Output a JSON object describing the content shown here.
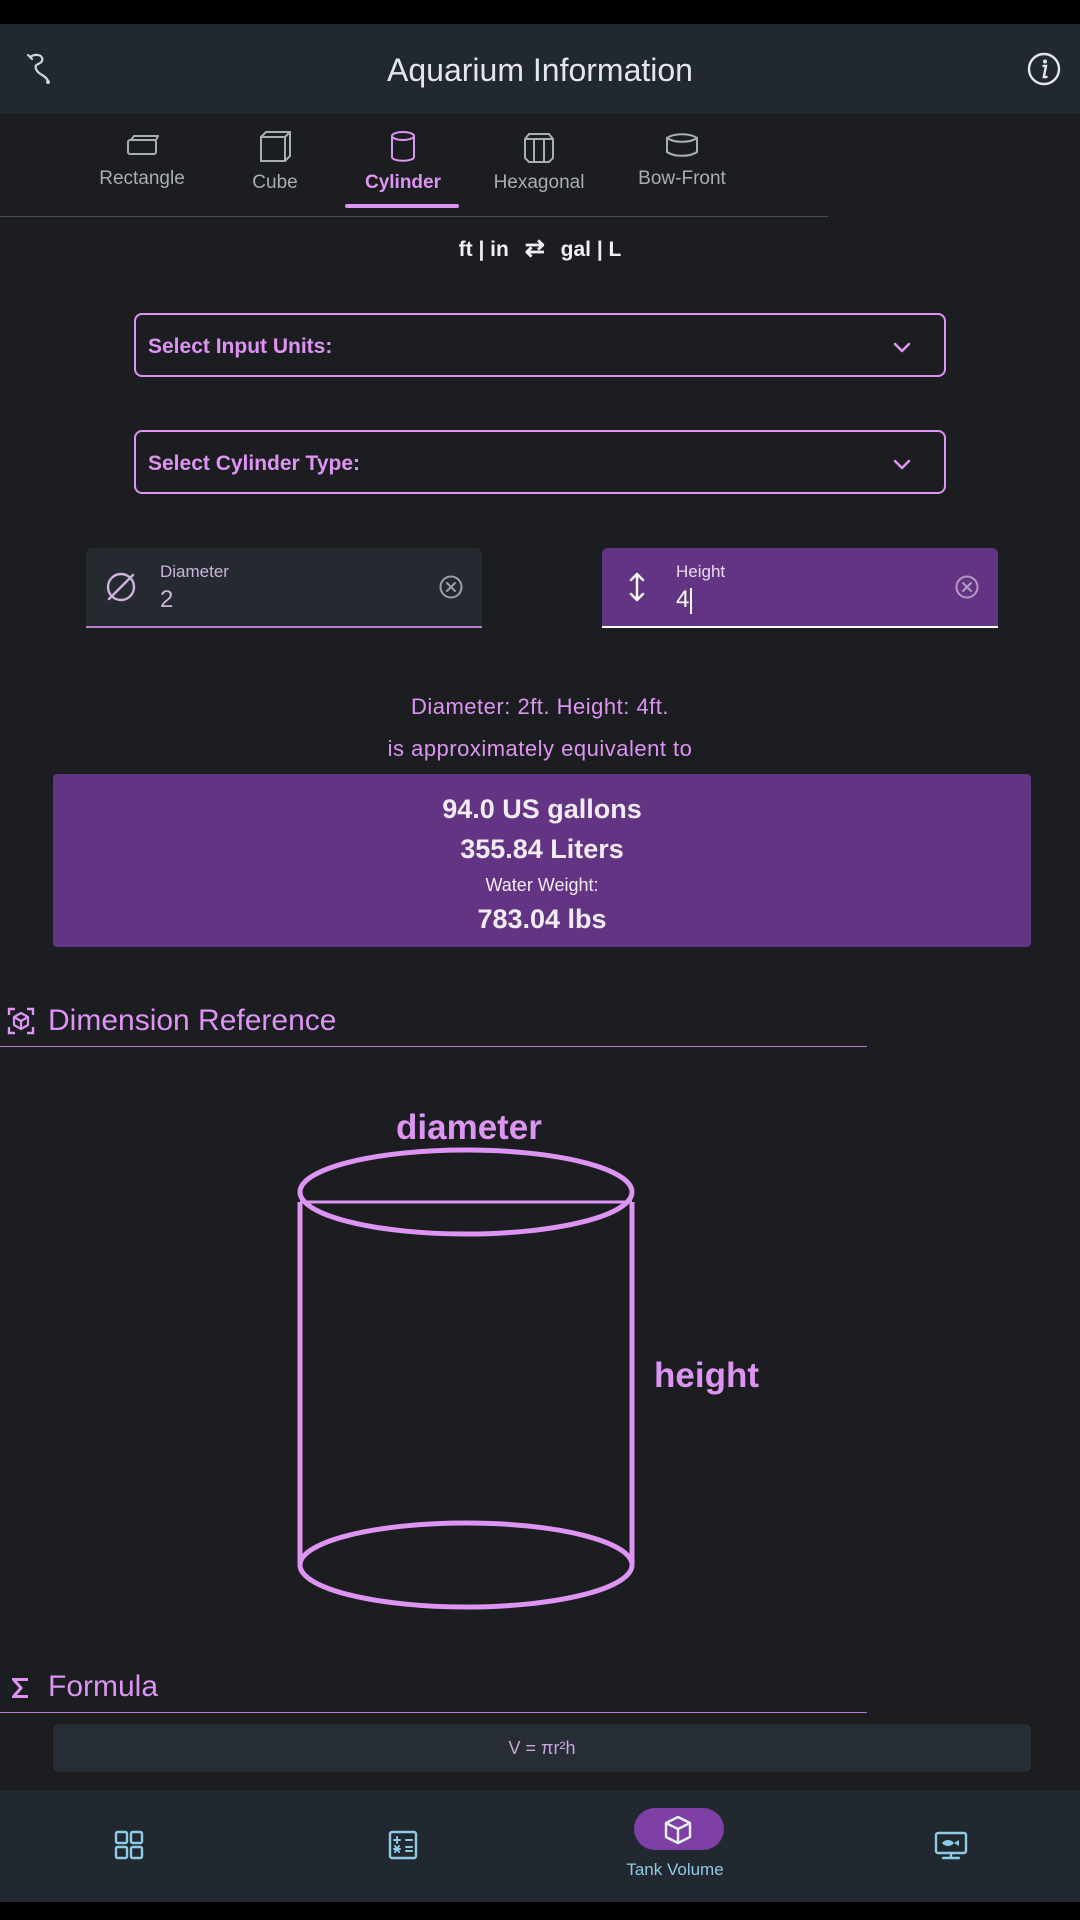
{
  "appbar": {
    "title": "Aquarium Information",
    "logo_icon": "fish-hook-icon",
    "info_icon": "info-icon"
  },
  "tabs": [
    {
      "label": "Rectangle",
      "icon": "rectangle-tank-icon",
      "active": false
    },
    {
      "label": "Cube",
      "icon": "cube-tank-icon",
      "active": false
    },
    {
      "label": "Cylinder",
      "icon": "cylinder-tank-icon",
      "active": true
    },
    {
      "label": "Hexagonal",
      "icon": "hexagonal-tank-icon",
      "active": false
    },
    {
      "label": "Bow-Front",
      "icon": "bowfront-tank-icon",
      "active": false
    }
  ],
  "unit_switch": {
    "left": "ft | in",
    "arrow": "⇄",
    "right": "gal | L"
  },
  "dropdowns": {
    "input_units": {
      "label": "Select Input Units:"
    },
    "cylinder_type": {
      "label": "Select Cylinder Type:"
    }
  },
  "fields": {
    "diameter": {
      "label": "Diameter",
      "value": "2"
    },
    "height": {
      "label": "Height",
      "value": "4"
    }
  },
  "summary": {
    "line1": "Diameter: 2ft. Height: 4ft.",
    "line2": "is approximately equivalent to"
  },
  "result": {
    "gallons": "94.0 US gallons",
    "liters": "355.84 Liters",
    "weight_label": "Water Weight:",
    "weight": "783.04 lbs"
  },
  "dimension_reference": {
    "title": "Dimension Reference",
    "diameter_label": "diameter",
    "height_label": "height"
  },
  "formula": {
    "title": "Formula",
    "text": "V = πr²h"
  },
  "navbar": {
    "items": [
      {
        "icon": "grid-icon",
        "label": ""
      },
      {
        "icon": "calculator-icon",
        "label": ""
      },
      {
        "icon": "cube-icon",
        "label": "Tank Volume",
        "active": true
      },
      {
        "icon": "aquarium-icon",
        "label": ""
      }
    ]
  },
  "colors": {
    "accent": "#dd94f2",
    "accent_fill": "#633483",
    "background": "#1b1d21",
    "surface": "#22282f",
    "nav_label": "#8ecbe6"
  }
}
